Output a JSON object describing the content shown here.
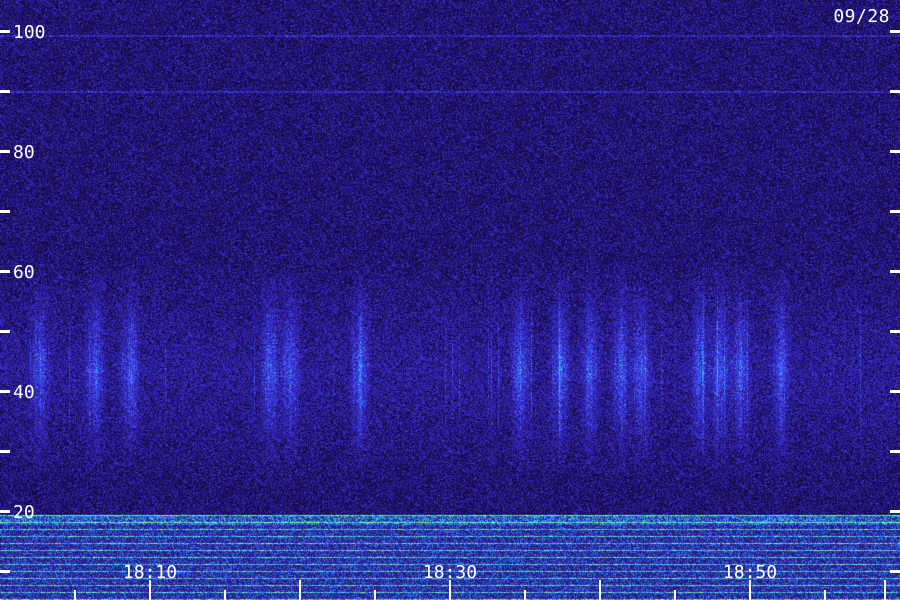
{
  "date_label": "09/28",
  "y_axis": {
    "tick_labels": [
      "100",
      "80",
      "60",
      "40",
      "20"
    ],
    "tick_values": [
      100,
      90,
      80,
      70,
      60,
      50,
      40,
      30,
      20,
      10
    ],
    "label_values": [
      100,
      80,
      60,
      40,
      20
    ],
    "range": [
      10,
      100
    ]
  },
  "x_axis": {
    "tick_labels": [
      "18:10",
      "18:30",
      "18:50"
    ]
  },
  "colors": {
    "background": "#1a0c4a",
    "noise_dark": "#1c0f5e",
    "noise_mid": "#3b2cc0",
    "noise_bright": "#4f63ff",
    "band_cyan": "#29d3c8",
    "band_green": "#5cff86",
    "tick_color": "#ffffff"
  }
}
